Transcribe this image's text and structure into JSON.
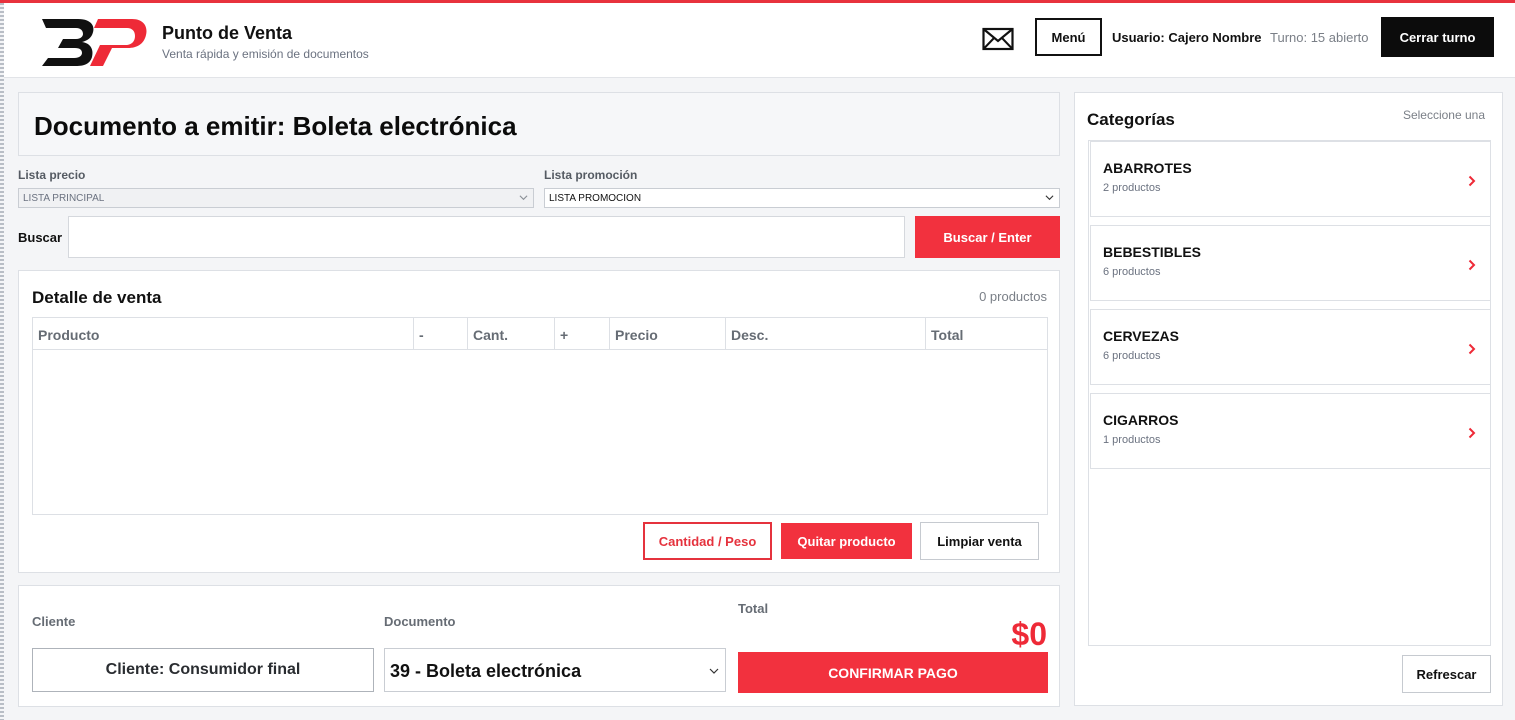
{
  "app": {
    "title": "Punto de Venta",
    "subtitle": "Venta rápida y emisión de documentos",
    "logo_text": "BP",
    "accent": "#f2313e"
  },
  "header": {
    "mail_icon": "envelope-icon",
    "menu_label": "Menú",
    "user_label": "Usuario: Cajero Nombre",
    "shift_label": "Turno: 15 abierto",
    "close_shift_label": "Cerrar turno"
  },
  "document": {
    "heading": "Documento a emitir: Boleta electrónica"
  },
  "filters": {
    "price_list_label": "Lista precio",
    "price_list_value": "LISTA PRINCIPAL",
    "promo_list_label": "Lista promoción",
    "promo_list_value": "LISTA PROMOCION"
  },
  "search": {
    "label": "Buscar",
    "value": "",
    "button_label": "Buscar / Enter"
  },
  "sale_detail": {
    "title": "Detalle de venta",
    "count_text": "0 productos",
    "columns": [
      "Producto",
      "-",
      "Cant.",
      "+",
      "Precio",
      "Desc.",
      "Total"
    ],
    "rows": [],
    "buttons": {
      "quantity": "Cantidad / Peso",
      "remove": "Quitar producto",
      "clear": "Limpiar venta"
    }
  },
  "checkout": {
    "client_label": "Cliente",
    "client_button": "Cliente: Consumidor final",
    "document_label": "Documento",
    "document_value": "39 - Boleta electrónica",
    "total_label": "Total",
    "total_value": "$0",
    "confirm_label": "CONFIRMAR PAGO"
  },
  "categories": {
    "title": "Categorías",
    "hint": "Seleccione una",
    "items": [
      {
        "name": "ABARROTES",
        "count": "2 productos"
      },
      {
        "name": "BEBESTIBLES",
        "count": "6 productos"
      },
      {
        "name": "CERVEZAS",
        "count": "6 productos"
      },
      {
        "name": "CIGARROS",
        "count": "1 productos"
      }
    ],
    "refresh_label": "Refrescar"
  }
}
